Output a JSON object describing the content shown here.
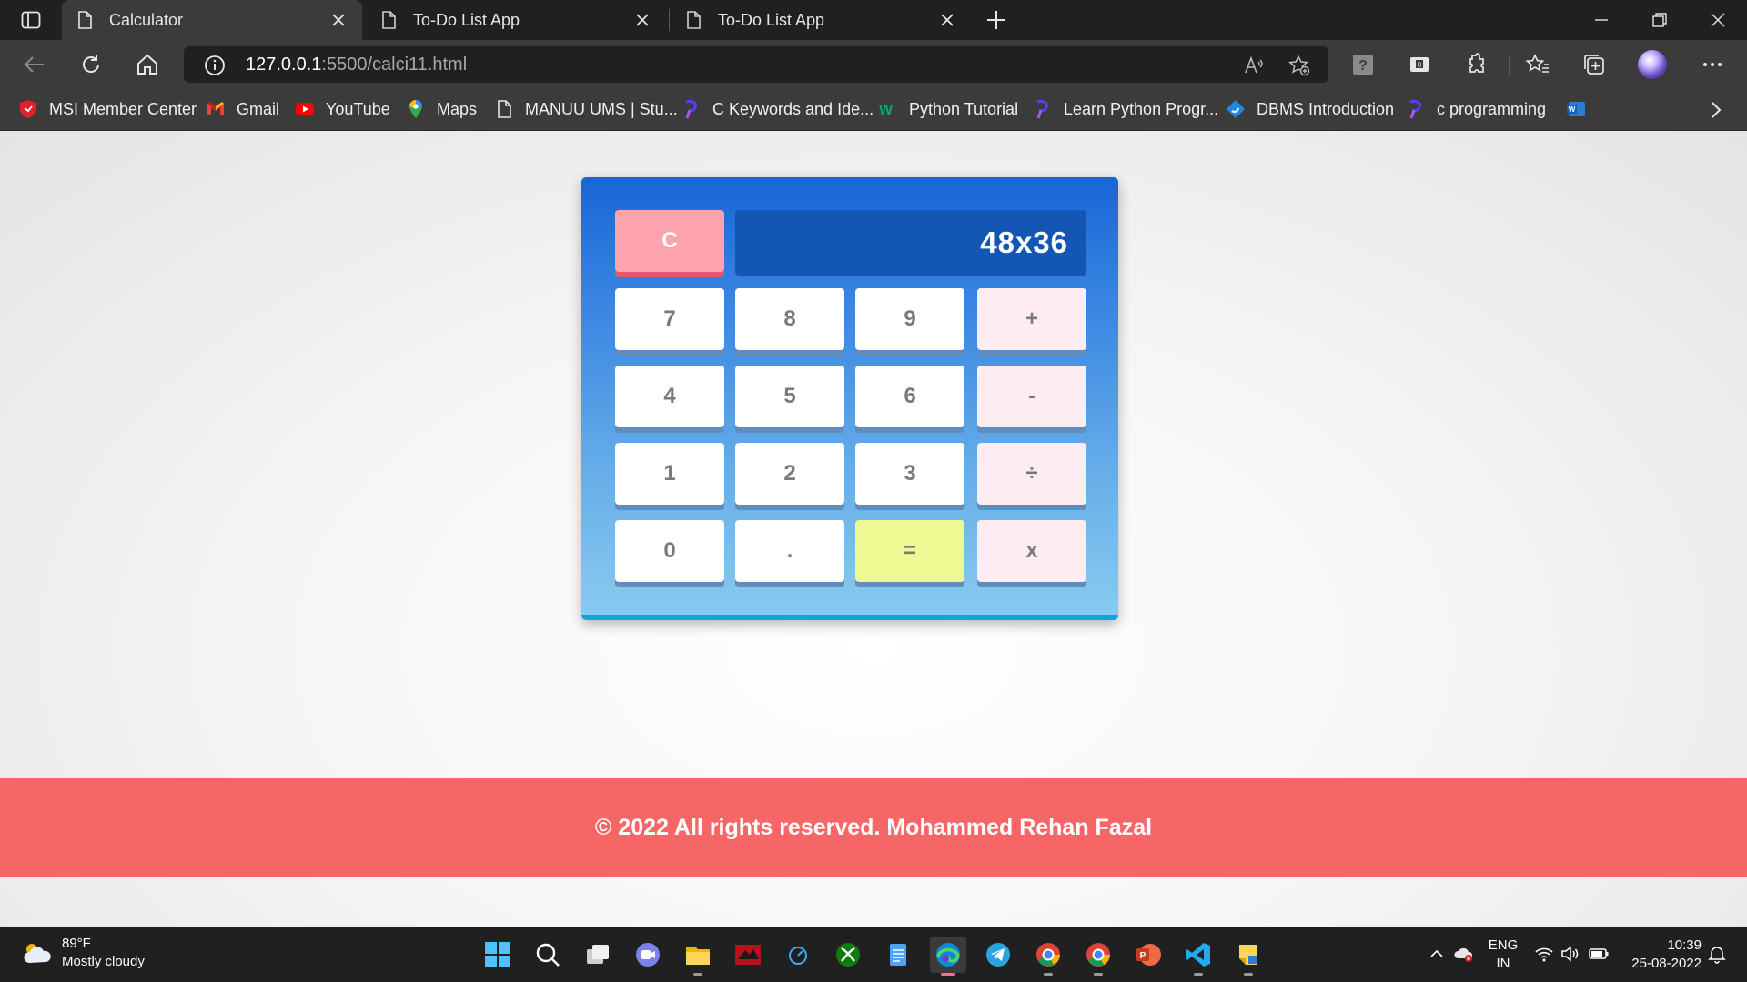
{
  "browser": {
    "tabs": [
      {
        "title": "Calculator",
        "active": true
      },
      {
        "title": "To-Do List App",
        "active": false
      },
      {
        "title": "To-Do List App",
        "active": false
      }
    ],
    "url": {
      "host": "127.0.0.1",
      "path": ":5500/calci11.html"
    },
    "bookmarks": [
      {
        "label": "MSI Member Center",
        "icon": "msi-icon"
      },
      {
        "label": "Gmail",
        "icon": "gmail-icon"
      },
      {
        "label": "YouTube",
        "icon": "youtube-icon"
      },
      {
        "label": "Maps",
        "icon": "maps-icon"
      },
      {
        "label": "MANUU UMS | Stu...",
        "icon": "page-icon"
      },
      {
        "label": "C Keywords and Ide...",
        "icon": "programiz-icon"
      },
      {
        "label": "Python Tutorial",
        "icon": "w3schools-icon"
      },
      {
        "label": "Learn Python Progr...",
        "icon": "programiz-icon"
      },
      {
        "label": "DBMS Introduction",
        "icon": "javatpoint-icon"
      },
      {
        "label": "c programming",
        "icon": "programiz-icon"
      },
      {
        "label": "",
        "icon": "word-icon"
      }
    ]
  },
  "calculator": {
    "display": "48x36",
    "clear_label": "C",
    "rows": [
      [
        "7",
        "8",
        "9",
        "+"
      ],
      [
        "4",
        "5",
        "6",
        "-"
      ],
      [
        "1",
        "2",
        "3",
        "÷"
      ],
      [
        "0",
        ".",
        "=",
        "x"
      ]
    ]
  },
  "footer": {
    "text": "© 2022 All rights reserved. Mohammed Rehan Fazal"
  },
  "taskbar": {
    "weather": {
      "temp": "89°F",
      "condition": "Mostly cloudy"
    },
    "lang": {
      "line1": "ENG",
      "line2": "IN"
    },
    "clock": {
      "time": "10:39",
      "date": "25-08-2022"
    }
  },
  "colors": {
    "calc_top": "#1766d6",
    "calc_bottom": "#88cbef",
    "display_bg": "#1456b4",
    "clear_key": "#fda3ad",
    "operator_key": "#fdecf1",
    "equals_key": "#edfa93",
    "footer_bg": "#f76667"
  }
}
